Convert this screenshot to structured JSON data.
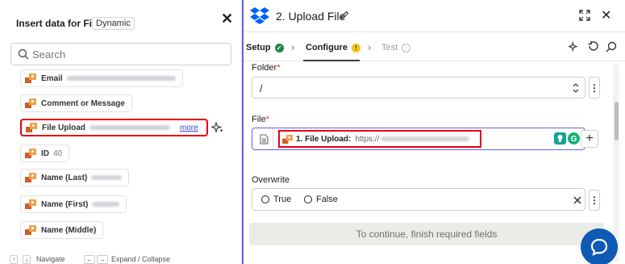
{
  "left_panel": {
    "title": "Insert data for File",
    "badge": "Dynamic",
    "search_placeholder": "Search",
    "items": [
      {
        "label": "Email"
      },
      {
        "label": "Comment or Message"
      },
      {
        "label": "File Upload",
        "more": "more"
      },
      {
        "label": "ID",
        "value": "40"
      },
      {
        "label": "Name (Last)"
      },
      {
        "label": "Name (First)"
      },
      {
        "label": "Name (Middle)"
      }
    ],
    "footer": {
      "navigate": "Navigate",
      "expand": "Expand / Collapse"
    }
  },
  "right_panel": {
    "title": "2. Upload File",
    "tabs": [
      {
        "label": "Setup",
        "status": "complete"
      },
      {
        "label": "Configure",
        "status": "warning"
      },
      {
        "label": "Test",
        "status": "disabled"
      }
    ],
    "fields": {
      "folder": {
        "label": "Folder",
        "required": "*",
        "value": "/"
      },
      "file": {
        "label": "File",
        "required": "*",
        "pill_label": "1. File Upload:",
        "pill_value": "https://"
      },
      "overwrite": {
        "label": "Overwrite",
        "options": [
          "True",
          "False"
        ]
      }
    },
    "cta": "To continue, finish required fields"
  },
  "colors": {
    "accent": "#6c5ee8",
    "highlight": "#e5000f",
    "success": "#1a8a45",
    "warning": "#f5c518",
    "chat": "#0e5ab4"
  }
}
